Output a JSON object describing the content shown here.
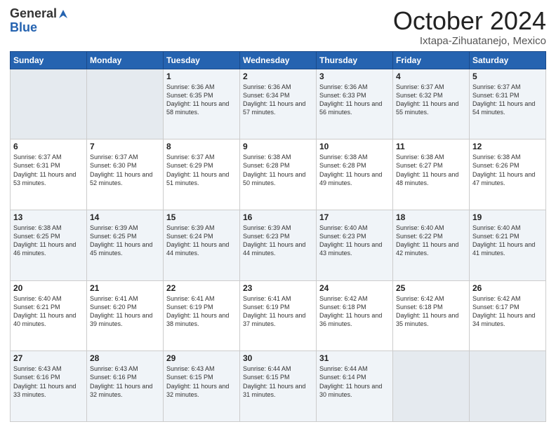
{
  "header": {
    "logo_general": "General",
    "logo_blue": "Blue",
    "month_title": "October 2024",
    "location": "Ixtapa-Zihuatanejo, Mexico"
  },
  "days_of_week": [
    "Sunday",
    "Monday",
    "Tuesday",
    "Wednesday",
    "Thursday",
    "Friday",
    "Saturday"
  ],
  "weeks": [
    [
      {
        "day": "",
        "info": ""
      },
      {
        "day": "",
        "info": ""
      },
      {
        "day": "1",
        "info": "Sunrise: 6:36 AM\nSunset: 6:35 PM\nDaylight: 11 hours and 58 minutes."
      },
      {
        "day": "2",
        "info": "Sunrise: 6:36 AM\nSunset: 6:34 PM\nDaylight: 11 hours and 57 minutes."
      },
      {
        "day": "3",
        "info": "Sunrise: 6:36 AM\nSunset: 6:33 PM\nDaylight: 11 hours and 56 minutes."
      },
      {
        "day": "4",
        "info": "Sunrise: 6:37 AM\nSunset: 6:32 PM\nDaylight: 11 hours and 55 minutes."
      },
      {
        "day": "5",
        "info": "Sunrise: 6:37 AM\nSunset: 6:31 PM\nDaylight: 11 hours and 54 minutes."
      }
    ],
    [
      {
        "day": "6",
        "info": "Sunrise: 6:37 AM\nSunset: 6:31 PM\nDaylight: 11 hours and 53 minutes."
      },
      {
        "day": "7",
        "info": "Sunrise: 6:37 AM\nSunset: 6:30 PM\nDaylight: 11 hours and 52 minutes."
      },
      {
        "day": "8",
        "info": "Sunrise: 6:37 AM\nSunset: 6:29 PM\nDaylight: 11 hours and 51 minutes."
      },
      {
        "day": "9",
        "info": "Sunrise: 6:38 AM\nSunset: 6:28 PM\nDaylight: 11 hours and 50 minutes."
      },
      {
        "day": "10",
        "info": "Sunrise: 6:38 AM\nSunset: 6:28 PM\nDaylight: 11 hours and 49 minutes."
      },
      {
        "day": "11",
        "info": "Sunrise: 6:38 AM\nSunset: 6:27 PM\nDaylight: 11 hours and 48 minutes."
      },
      {
        "day": "12",
        "info": "Sunrise: 6:38 AM\nSunset: 6:26 PM\nDaylight: 11 hours and 47 minutes."
      }
    ],
    [
      {
        "day": "13",
        "info": "Sunrise: 6:38 AM\nSunset: 6:25 PM\nDaylight: 11 hours and 46 minutes."
      },
      {
        "day": "14",
        "info": "Sunrise: 6:39 AM\nSunset: 6:25 PM\nDaylight: 11 hours and 45 minutes."
      },
      {
        "day": "15",
        "info": "Sunrise: 6:39 AM\nSunset: 6:24 PM\nDaylight: 11 hours and 44 minutes."
      },
      {
        "day": "16",
        "info": "Sunrise: 6:39 AM\nSunset: 6:23 PM\nDaylight: 11 hours and 44 minutes."
      },
      {
        "day": "17",
        "info": "Sunrise: 6:40 AM\nSunset: 6:23 PM\nDaylight: 11 hours and 43 minutes."
      },
      {
        "day": "18",
        "info": "Sunrise: 6:40 AM\nSunset: 6:22 PM\nDaylight: 11 hours and 42 minutes."
      },
      {
        "day": "19",
        "info": "Sunrise: 6:40 AM\nSunset: 6:21 PM\nDaylight: 11 hours and 41 minutes."
      }
    ],
    [
      {
        "day": "20",
        "info": "Sunrise: 6:40 AM\nSunset: 6:21 PM\nDaylight: 11 hours and 40 minutes."
      },
      {
        "day": "21",
        "info": "Sunrise: 6:41 AM\nSunset: 6:20 PM\nDaylight: 11 hours and 39 minutes."
      },
      {
        "day": "22",
        "info": "Sunrise: 6:41 AM\nSunset: 6:19 PM\nDaylight: 11 hours and 38 minutes."
      },
      {
        "day": "23",
        "info": "Sunrise: 6:41 AM\nSunset: 6:19 PM\nDaylight: 11 hours and 37 minutes."
      },
      {
        "day": "24",
        "info": "Sunrise: 6:42 AM\nSunset: 6:18 PM\nDaylight: 11 hours and 36 minutes."
      },
      {
        "day": "25",
        "info": "Sunrise: 6:42 AM\nSunset: 6:18 PM\nDaylight: 11 hours and 35 minutes."
      },
      {
        "day": "26",
        "info": "Sunrise: 6:42 AM\nSunset: 6:17 PM\nDaylight: 11 hours and 34 minutes."
      }
    ],
    [
      {
        "day": "27",
        "info": "Sunrise: 6:43 AM\nSunset: 6:16 PM\nDaylight: 11 hours and 33 minutes."
      },
      {
        "day": "28",
        "info": "Sunrise: 6:43 AM\nSunset: 6:16 PM\nDaylight: 11 hours and 32 minutes."
      },
      {
        "day": "29",
        "info": "Sunrise: 6:43 AM\nSunset: 6:15 PM\nDaylight: 11 hours and 32 minutes."
      },
      {
        "day": "30",
        "info": "Sunrise: 6:44 AM\nSunset: 6:15 PM\nDaylight: 11 hours and 31 minutes."
      },
      {
        "day": "31",
        "info": "Sunrise: 6:44 AM\nSunset: 6:14 PM\nDaylight: 11 hours and 30 minutes."
      },
      {
        "day": "",
        "info": ""
      },
      {
        "day": "",
        "info": ""
      }
    ]
  ]
}
